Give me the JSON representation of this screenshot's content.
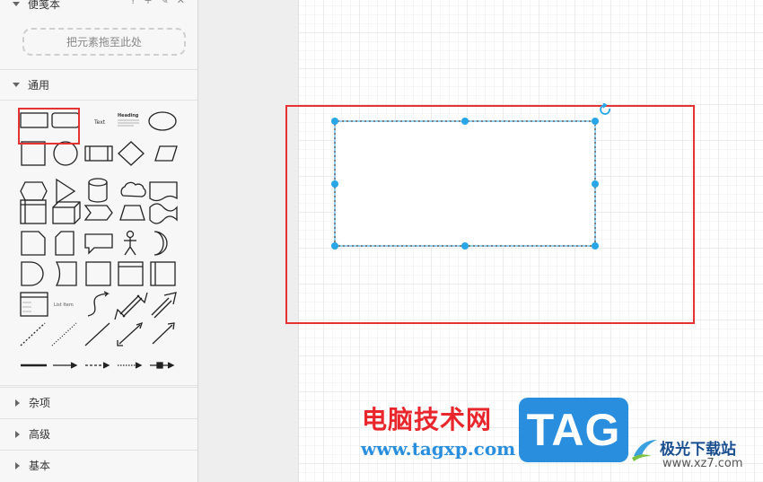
{
  "sidebar": {
    "scratchpad": {
      "title": "便笺本",
      "tools": [
        "?",
        "+",
        "✎",
        "✕"
      ],
      "drop_hint": "把元素拖至此处"
    },
    "general": {
      "title": "通用"
    },
    "sections": [
      {
        "title": "杂项"
      },
      {
        "title": "高级"
      },
      {
        "title": "基本"
      }
    ],
    "shape_labels": {
      "text": "Text",
      "heading": "Heading",
      "list_item": "List Item"
    }
  },
  "watermark": {
    "site_name": "电脑技术网",
    "site_url": "www.tagxp.com",
    "tag_logo": "TAG",
    "brand2": "极光下载站",
    "brand2_url": "www.xz7.com"
  },
  "colors": {
    "selection": "#29a6e5",
    "highlight": "#e53333",
    "watermark_red": "#e8262b",
    "watermark_blue": "#2a8ede"
  }
}
